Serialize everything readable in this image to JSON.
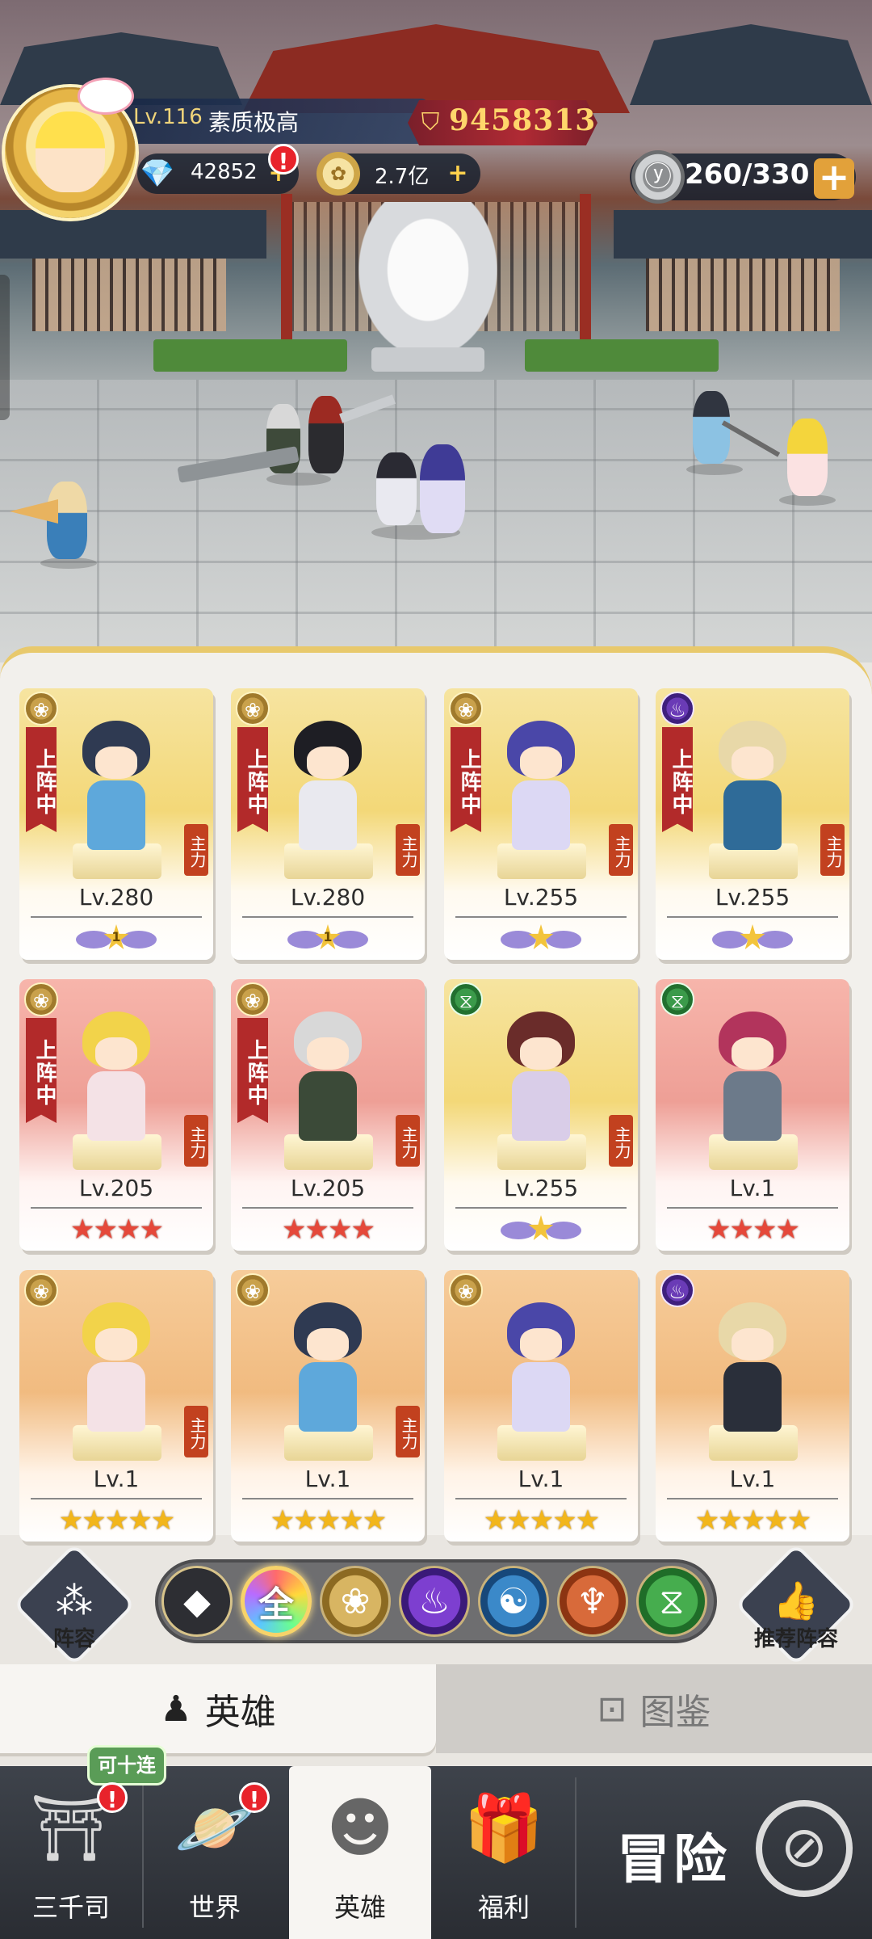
{
  "player": {
    "level": "Lv.116",
    "title": "素质极高",
    "power": "9458313"
  },
  "resources": {
    "diamonds": "42852",
    "coins": "2.7亿",
    "coins_plus": "+",
    "stamina": "260/330",
    "stamina_plus": "+",
    "alert": "!"
  },
  "heroes": [
    {
      "level": "Lv.280",
      "deployed": "上阵中",
      "main": "主力",
      "rank": "awaken",
      "awaken_num": "1",
      "badge": "lotus",
      "badge_color": "gold",
      "card_color": "gold"
    },
    {
      "level": "Lv.280",
      "deployed": "上阵中",
      "main": "主力",
      "rank": "awaken",
      "awaken_num": "1",
      "badge": "lotus",
      "badge_color": "gold",
      "card_color": "gold"
    },
    {
      "level": "Lv.255",
      "deployed": "上阵中",
      "main": "主力",
      "rank": "awaken",
      "awaken_num": "",
      "badge": "lotus",
      "badge_color": "gold",
      "card_color": "gold"
    },
    {
      "level": "Lv.255",
      "deployed": "上阵中",
      "main": "主力",
      "rank": "awaken",
      "awaken_num": "",
      "badge": "flame",
      "badge_color": "purple",
      "card_color": "gold"
    },
    {
      "level": "Lv.205",
      "deployed": "上阵中",
      "main": "主力",
      "rank": "red-stars",
      "stars": "★★★★",
      "badge": "lotus",
      "badge_color": "gold",
      "card_color": "red"
    },
    {
      "level": "Lv.205",
      "deployed": "上阵中",
      "main": "主力",
      "rank": "red-stars",
      "stars": "★★★★",
      "badge": "lotus",
      "badge_color": "gold",
      "card_color": "red"
    },
    {
      "level": "Lv.255",
      "deployed": "",
      "main": "主力",
      "rank": "awaken",
      "awaken_num": "",
      "badge": "dna",
      "badge_color": "green",
      "card_color": "gold"
    },
    {
      "level": "Lv.1",
      "deployed": "",
      "main": "",
      "rank": "red-stars",
      "stars": "★★★★",
      "badge": "dna",
      "badge_color": "green",
      "card_color": "red"
    },
    {
      "level": "Lv.1",
      "deployed": "",
      "main": "主力",
      "rank": "gold-stars",
      "stars": "★★★★★",
      "badge": "lotus",
      "badge_color": "gold",
      "card_color": "orange"
    },
    {
      "level": "Lv.1",
      "deployed": "",
      "main": "主力",
      "rank": "gold-stars",
      "stars": "★★★★★",
      "badge": "lotus",
      "badge_color": "gold",
      "card_color": "orange"
    },
    {
      "level": "Lv.1",
      "deployed": "",
      "main": "",
      "rank": "gold-stars",
      "stars": "★★★★★",
      "badge": "lotus",
      "badge_color": "gold",
      "card_color": "orange"
    },
    {
      "level": "Lv.1",
      "deployed": "",
      "main": "",
      "rank": "gold-stars",
      "stars": "★★★★★",
      "badge": "flame",
      "badge_color": "purple",
      "card_color": "orange"
    }
  ],
  "filters": {
    "lineup_label": "阵容",
    "recommend_label": "推荐阵容",
    "all_label": "全",
    "items": [
      "diamond-grid",
      "all",
      "lotus",
      "flame",
      "yin-yang",
      "meditation",
      "dna"
    ]
  },
  "subtabs": {
    "heroes": "英雄",
    "codex": "图鉴"
  },
  "nav": {
    "sanqiansi": "三千司",
    "world": "世界",
    "heroes": "英雄",
    "welfare": "福利",
    "adventure": "冒险",
    "ten_pull_bubble": "可十连"
  },
  "colors": {
    "accent_gold": "#e8c96c",
    "power_text": "#ffd66b",
    "deployed_ribbon": "#b22a2a",
    "main_tag": "#c2411f",
    "alert_red": "#e8232b"
  }
}
